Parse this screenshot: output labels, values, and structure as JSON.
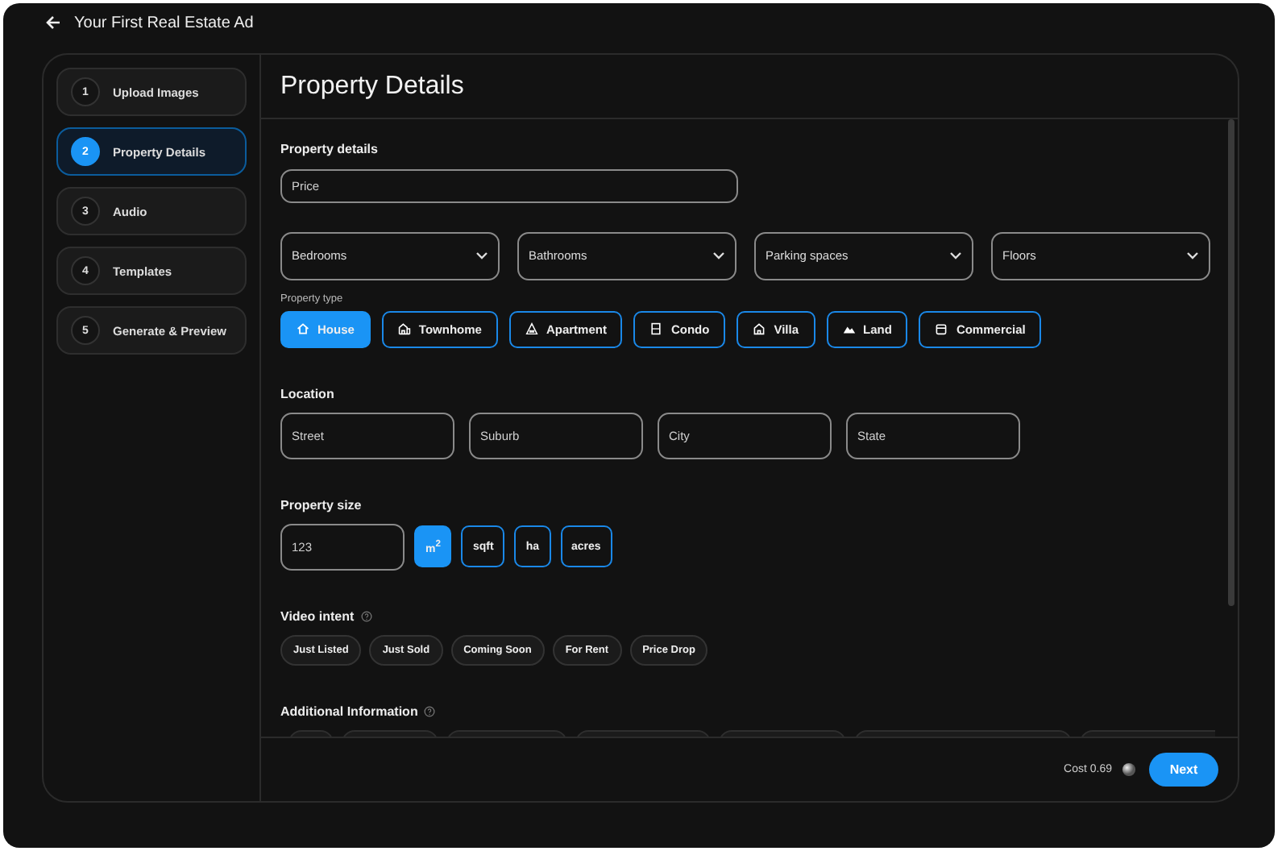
{
  "window": {
    "title": "Your First Real Estate Ad"
  },
  "steps": [
    {
      "number": "1",
      "label": "Upload Images",
      "selected": false
    },
    {
      "number": "2",
      "label": "Property Details",
      "selected": true
    },
    {
      "number": "3",
      "label": "Audio",
      "selected": false
    },
    {
      "number": "4",
      "label": "Templates",
      "selected": false
    },
    {
      "number": "5",
      "label": "Generate & Preview",
      "selected": false
    }
  ],
  "page_title": "Property Details",
  "property_details": {
    "heading": "Property details",
    "price": {
      "placeholder": "Price"
    },
    "dropdowns": [
      {
        "label": "Bedrooms"
      },
      {
        "label": "Bathrooms"
      },
      {
        "label": "Parking spaces"
      },
      {
        "label": "Floors"
      }
    ],
    "property_type_label": "Property type",
    "property_types": [
      {
        "label": "House",
        "selected": true
      },
      {
        "label": "Townhome",
        "selected": false
      },
      {
        "label": "Apartment",
        "selected": false
      },
      {
        "label": "Condo",
        "selected": false
      },
      {
        "label": "Villa",
        "selected": false
      },
      {
        "label": "Land",
        "selected": false
      },
      {
        "label": "Commercial",
        "selected": false
      }
    ]
  },
  "location": {
    "heading": "Location",
    "fields": [
      {
        "placeholder": "Street"
      },
      {
        "placeholder": "Suburb"
      },
      {
        "placeholder": "City"
      },
      {
        "placeholder": "State"
      }
    ]
  },
  "property_size": {
    "heading": "Property size",
    "field": {
      "placeholder": "123"
    },
    "units": [
      {
        "label": "m$^{2}$",
        "selected": true
      },
      {
        "label": "sqft",
        "selected": false
      },
      {
        "label": "ha",
        "selected": false
      },
      {
        "label": "acres",
        "selected": false
      }
    ]
  },
  "video_intent": {
    "heading": "Video intent",
    "options": [
      {
        "label": "Just Listed",
        "selected": false
      },
      {
        "label": "Just Sold",
        "selected": false
      },
      {
        "label": "Coming Soon",
        "selected": false
      },
      {
        "label": "For Rent",
        "selected": false
      },
      {
        "label": "Price Drop",
        "selected": false
      }
    ]
  },
  "additional_information": {
    "heading": "Additional Information"
  },
  "footer": {
    "cost": "Cost 0.69",
    "button": "Next"
  }
}
